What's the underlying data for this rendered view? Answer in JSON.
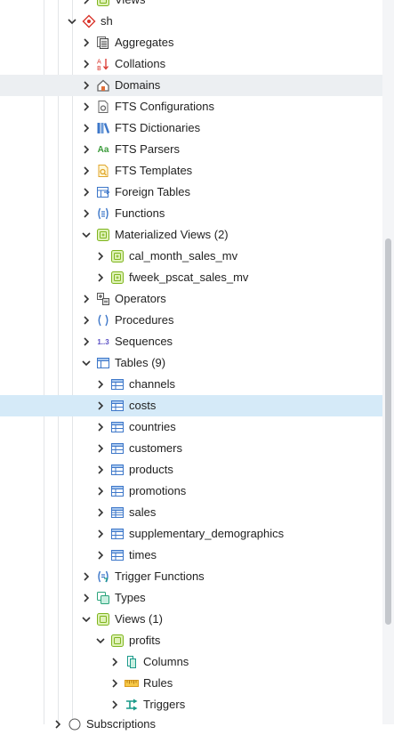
{
  "tree": {
    "views_top": "Views",
    "schema": "sh",
    "items": {
      "aggregates": "Aggregates",
      "collations": "Collations",
      "domains": "Domains",
      "fts_configurations": "FTS Configurations",
      "fts_dictionaries": "FTS Dictionaries",
      "fts_parsers": "FTS Parsers",
      "fts_templates": "FTS Templates",
      "foreign_tables": "Foreign Tables",
      "functions": "Functions",
      "materialized_views": "Materialized Views (2)",
      "mv_cal_month": "cal_month_sales_mv",
      "mv_fweek": "fweek_pscat_sales_mv",
      "operators": "Operators",
      "procedures": "Procedures",
      "sequences": "Sequences",
      "tables": "Tables (9)",
      "t_channels": "channels",
      "t_costs": "costs",
      "t_countries": "countries",
      "t_customers": "customers",
      "t_products": "products",
      "t_promotions": "promotions",
      "t_sales": "sales",
      "t_supplementary": "supplementary_demographics",
      "t_times": "times",
      "trigger_functions": "Trigger Functions",
      "types": "Types",
      "views": "Views (1)",
      "v_profits": "profits",
      "v_columns": "Columns",
      "v_rules": "Rules",
      "v_triggers": "Triggers",
      "subscriptions": "Subscriptions"
    },
    "icon_text": {
      "fts_parsers": "Aa",
      "sequences": "1..3"
    }
  }
}
